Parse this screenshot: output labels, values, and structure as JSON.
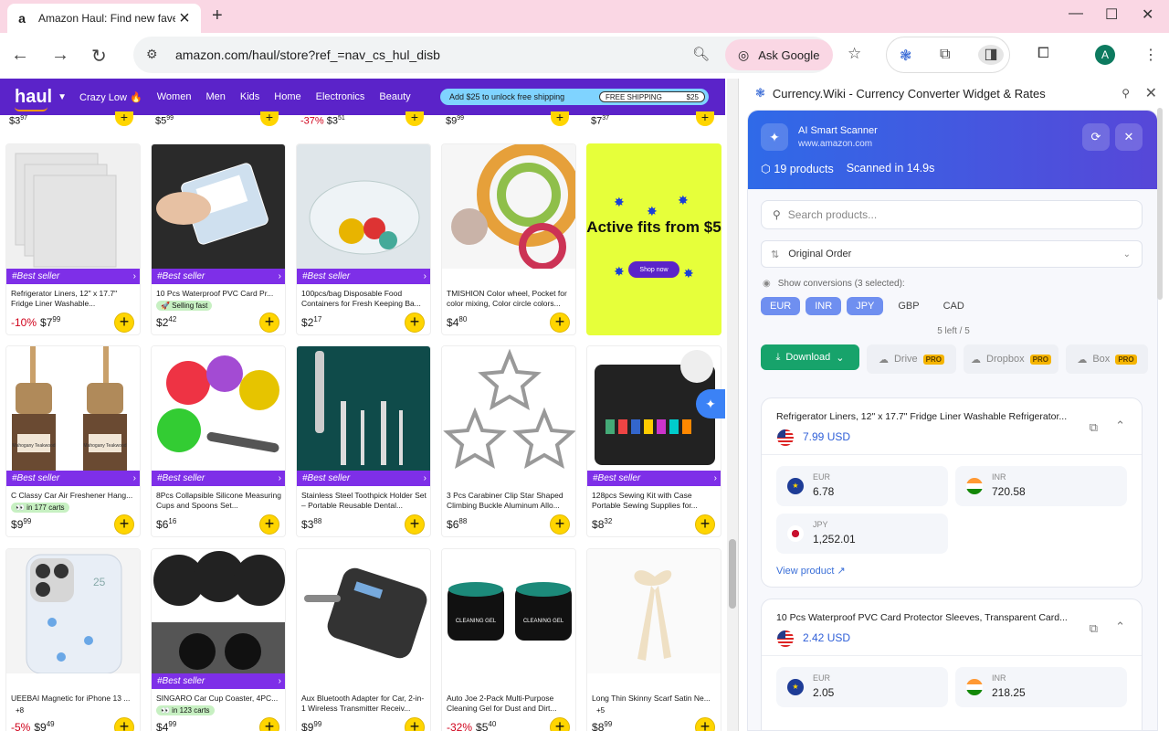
{
  "browser": {
    "tab_title": "Amazon Haul: Find new fave",
    "url": "amazon.com/haul/store?ref_=nav_cs_hul_disb",
    "ask_google": "Ask Google",
    "avatar_letter": "A"
  },
  "haul": {
    "logo": "haul",
    "nav": [
      "Crazy Low 🔥",
      "Women",
      "Men",
      "Kids",
      "Home",
      "Electronics",
      "Beauty"
    ],
    "promo_text": "Add $25 to unlock free shipping",
    "promo_ship": "FREE SHIPPING",
    "promo_amount": "$25",
    "top_prices": [
      {
        "dollars": "3",
        "cents": "97",
        "disc": ""
      },
      {
        "dollars": "5",
        "cents": "99",
        "disc": ""
      },
      {
        "dollars": "3",
        "cents": "51",
        "disc": "-37%"
      },
      {
        "dollars": "9",
        "cents": "99",
        "disc": ""
      },
      {
        "dollars": "7",
        "cents": "37",
        "disc": ""
      }
    ],
    "products": [
      {
        "name": "Refrigerator Liners, 12\" x 17.7\" Fridge Liner Washable...",
        "badge": "#Best seller",
        "chip": "",
        "disc": "-10%",
        "dollars": "7",
        "cents": "99"
      },
      {
        "name": "10 Pcs Waterproof PVC Card Pr...",
        "badge": "#Best seller",
        "chip": "🚀 Selling fast",
        "disc": "",
        "dollars": "2",
        "cents": "42"
      },
      {
        "name": "100pcs/bag Disposable Food Containers for Fresh Keeping Ba...",
        "badge": "#Best seller",
        "chip": "",
        "disc": "",
        "dollars": "2",
        "cents": "17"
      },
      {
        "name": "TMISHION Color wheel, Pocket for color mixing, Color circle colors...",
        "badge": "",
        "chip": "",
        "disc": "",
        "dollars": "4",
        "cents": "80"
      },
      {
        "name": "C Classy Car Air Freshener Hang...",
        "badge": "#Best seller",
        "chip": "👀 in 177 carts",
        "disc": "",
        "dollars": "9",
        "cents": "99"
      },
      {
        "name": "8Pcs Collapsible Silicone Measuring Cups and Spoons Set...",
        "badge": "#Best seller",
        "chip": "",
        "disc": "",
        "dollars": "6",
        "cents": "16"
      },
      {
        "name": "Stainless Steel Toothpick Holder Set – Portable Reusable Dental...",
        "badge": "#Best seller",
        "chip": "",
        "disc": "",
        "dollars": "3",
        "cents": "88"
      },
      {
        "name": "3 Pcs Carabiner Clip Star Shaped Climbing Buckle Aluminum Allo...",
        "badge": "",
        "chip": "",
        "disc": "",
        "dollars": "6",
        "cents": "88"
      },
      {
        "name": "128pcs Sewing Kit with Case Portable Sewing Supplies for...",
        "badge": "#Best seller",
        "chip": "",
        "disc": "",
        "dollars": "8",
        "cents": "32"
      },
      {
        "name": "UEEBAI Magnetic for iPhone 13 ...",
        "badge": "",
        "chip": "+8",
        "disc": "-5%",
        "dollars": "9",
        "cents": "49"
      },
      {
        "name": "SINGARO Car Cup Coaster, 4PC...",
        "badge": "#Best seller",
        "chip": "👀 in 123 carts",
        "disc": "",
        "dollars": "4",
        "cents": "99"
      },
      {
        "name": "Aux Bluetooth Adapter for Car, 2-in-1 Wireless Transmitter Receiv...",
        "badge": "",
        "chip": "",
        "disc": "",
        "dollars": "9",
        "cents": "99"
      },
      {
        "name": "Auto Joe 2-Pack Multi-Purpose Cleaning Gel for Dust and Dirt...",
        "badge": "",
        "chip": "",
        "disc": "-32%",
        "dollars": "5",
        "cents": "40"
      },
      {
        "name": "Long Thin Skinny Scarf Satin Ne...",
        "badge": "",
        "chip": "+5",
        "disc": "",
        "dollars": "8",
        "cents": "99"
      }
    ],
    "ad": {
      "title": "Active fits from $5",
      "button": "Shop now"
    },
    "cleaning_gel_label": "CLEANING GEL",
    "freshener_label": "Mahogany Teakwood",
    "phone_text": "25"
  },
  "panel": {
    "title": "Currency.Wiki - Currency Converter Widget & Rates",
    "scanner_title": "AI Smart Scanner",
    "scanner_site": "www.amazon.com",
    "product_count": "19 products",
    "scan_time": "Scanned in 14.9s",
    "search_placeholder": "Search products...",
    "sort": "Original Order",
    "show_conversions": "Show conversions (3 selected):",
    "currencies": [
      {
        "code": "EUR",
        "on": true
      },
      {
        "code": "INR",
        "on": true
      },
      {
        "code": "JPY",
        "on": true
      },
      {
        "code": "GBP",
        "on": false
      },
      {
        "code": "CAD",
        "on": false
      }
    ],
    "left": "5 left / 5",
    "download": "Download",
    "drive": "Drive",
    "dropbox": "Dropbox",
    "box": "Box",
    "pro": "PRO",
    "cards": [
      {
        "name": "Refrigerator Liners, 12\" x 17.7\" Fridge Liner Washable Refrigerator...",
        "usd": "7.99 USD",
        "eur": "6.78",
        "inr": "720.58",
        "jpy": "1,252.01",
        "view": "View product"
      },
      {
        "name": "10 Pcs Waterproof PVC Card Protector Sleeves, Transparent Card...",
        "usd": "2.42 USD",
        "eur": "2.05",
        "inr": "218.25"
      }
    ],
    "labels": {
      "eur": "EUR",
      "inr": "INR",
      "jpy": "JPY"
    }
  }
}
